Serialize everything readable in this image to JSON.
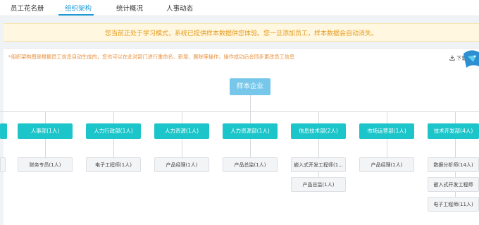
{
  "tabs": [
    {
      "label": "员工花名册"
    },
    {
      "label": "组织架构"
    },
    {
      "label": "统计概况"
    },
    {
      "label": "人事动态"
    }
  ],
  "notice": {
    "text": "您当前正处于学习模式，系统已提供样本数据供您体验。您一旦添加员工，样本数据会自动消失。"
  },
  "org": {
    "hint": "*组织架构图是根据员工信息自动生成的，您也可以在此对部门进行重命名、新增、删除等操作，操作成功后会同步更改员工信息",
    "download_label": "下载",
    "root": "样本企业",
    "departments": [
      {
        "name": "人事部(1人)",
        "positions": [
          "财务专员(1人)"
        ]
      },
      {
        "name": "人力行政部(1人)",
        "positions": [
          "电子工程师(1人)"
        ]
      },
      {
        "name": "人力资源(1人)",
        "positions": [
          "产品经理(1人)"
        ]
      },
      {
        "name": "人力资源部(1人)",
        "positions": [
          "产品总监(1人)"
        ]
      },
      {
        "name": "信息技术部(2人)",
        "positions": [
          "嵌入式开发工程师(1...",
          "产品总监(1人)"
        ]
      },
      {
        "name": "市场运营部(1人)",
        "positions": [
          "产品经理(1人)"
        ]
      },
      {
        "name": "技术开发部(4人)",
        "positions": [
          "数据分析师(14人)",
          "嵌入式开发工程师",
          "电子工程师(11人)"
        ]
      }
    ]
  },
  "colors": {
    "accent": "#1e9ad6",
    "root_node": "#76c7ea",
    "dept_node": "#1cc5c9",
    "notice_text": "#e59b1f"
  }
}
